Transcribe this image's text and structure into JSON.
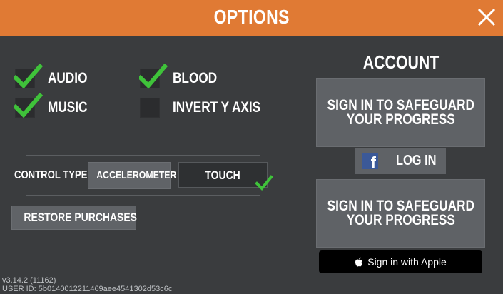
{
  "header": {
    "title": "OPTIONS"
  },
  "options": {
    "audio": {
      "label": "AUDIO",
      "checked": true
    },
    "blood": {
      "label": "BLOOD",
      "checked": true
    },
    "music": {
      "label": "MUSIC",
      "checked": true
    },
    "invert_y": {
      "label": "INVERT Y AXIS",
      "checked": false
    }
  },
  "control": {
    "label": "CONTROL TYPE:",
    "accelerometer": "ACCELEROMETER",
    "touch": "TOUCH",
    "selected": "TOUCH"
  },
  "restore_label": "RESTORE PURCHASES",
  "version": "v3.14.2 (11162)",
  "user_id": "USER ID: 5b014001221146​9aee4541302d53c6c",
  "account": {
    "title": "ACCOUNT",
    "signin_line1": "SIGN IN TO SAFEGUARD",
    "signin_line2": "YOUR PROGRESS",
    "facebook_label": "LOG IN",
    "apple_label": "Sign in with Apple"
  },
  "colors": {
    "header": "#e07a34",
    "background": "#3a3c3e",
    "check": "#3fc23a",
    "facebook": "#3b5998"
  }
}
